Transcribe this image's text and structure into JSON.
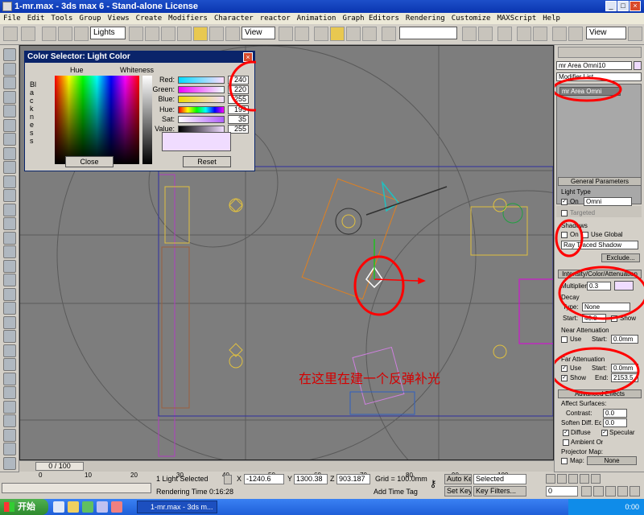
{
  "window": {
    "title": "1-mr.max - 3ds max 6 - Stand-alone License"
  },
  "menu": [
    "File",
    "Edit",
    "Tools",
    "Group",
    "Views",
    "Create",
    "Modifiers",
    "Character",
    "reactor",
    "Animation",
    "Graph Editors",
    "Rendering",
    "Customize",
    "MAXScript",
    "Help"
  ],
  "toolbar": {
    "selection_filter": "Lights",
    "ref_coord": "View",
    "ref_coord_right": "View"
  },
  "color_selector": {
    "title": "Color Selector: Light Color",
    "hue_label": "Hue",
    "whiteness_label": "Whiteness",
    "blackness_label": "Blackness",
    "rows": [
      {
        "label": "Red:",
        "value": "240"
      },
      {
        "label": "Green:",
        "value": "220"
      },
      {
        "label": "Blue:",
        "value": "255"
      },
      {
        "label": "Hue:",
        "value": "199"
      },
      {
        "label": "Sat:",
        "value": "35"
      },
      {
        "label": "Value:",
        "value": "255"
      }
    ],
    "close_label": "Close",
    "reset_label": "Reset",
    "swatch_color": "#f0dcff"
  },
  "viewport": {
    "annotation": "在这里在建一个反弹补光",
    "annotation_color": "#d40000",
    "marker_color": "#ff0000"
  },
  "command_panel": {
    "object_name": "mr Area Omni10",
    "modifier_list": "Modifier List",
    "modifier_stack_item": "mr Area Omni",
    "general_parameters": "General Parameters",
    "light_type_label": "Light Type",
    "on_label": "On",
    "light_type_value": "Omni",
    "targeted_label": "Targeted",
    "shadows_label": "Shadows",
    "use_global_label": "Use Global",
    "shadow_type": "Ray Traced Shadow",
    "exclude_label": "Exclude...",
    "intensity_header": "Intensity/Color/Attenuation",
    "multiplier_label": "Multiplier:",
    "multiplier_value": "0.3",
    "light_color": "#f0dcff",
    "decay_label": "Decay",
    "decay_type_label": "Type:",
    "decay_type_value": "None",
    "start_label": "Start:",
    "decay_start_value": "40.0",
    "show_label": "Show",
    "near_atten_label": "Near Attenuation",
    "use_label": "Use",
    "near_start_value": "0.0mm",
    "far_atten_label": "Far Attenuation",
    "far_start_value": "0.0mm",
    "end_label": "End:",
    "far_end_value": "2153.5",
    "advanced_effects": "Advanced Effects",
    "affect_surfaces": "Affect Surfaces:",
    "contrast_label": "Contrast:",
    "contrast_value": "0.0",
    "soften_label": "Soften Diff. Edge:",
    "soften_value": "0.0",
    "diffuse_label": "Diffuse",
    "specular_label": "Specular",
    "ambient_label": "Ambient Only",
    "projector_map": "Projector Map:",
    "map_label": "Map:",
    "map_value": "None"
  },
  "timeline": {
    "frame": "0 / 100",
    "ticks": [
      "0",
      "10",
      "20",
      "30",
      "40",
      "50",
      "60",
      "70",
      "80",
      "90",
      "100"
    ]
  },
  "status": {
    "selection": "1 Light Selected",
    "render_time": "Rendering Time  0:16:28",
    "x": "-1240.6",
    "y": "1300.38",
    "z": "903.187",
    "grid": "Grid = 100.0mm",
    "add_time_tag": "Add Time Tag",
    "auto_key": "Auto Key",
    "set_key": "Set Key",
    "selected": "Selected",
    "key_filters": "Key Filters...",
    "frame_value": "0"
  },
  "taskbar": {
    "start": "开始",
    "task": "1-mr.max - 3ds m...",
    "clock": "0:00"
  }
}
